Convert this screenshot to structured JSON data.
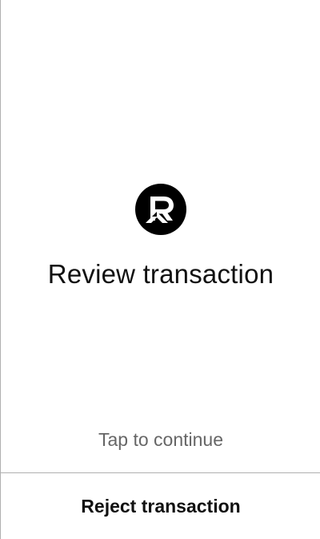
{
  "screen": {
    "logo_icon": "r-brand-logo-icon",
    "title": "Review transaction",
    "tap_hint": "Tap to continue"
  },
  "footer": {
    "reject_label": "Reject transaction"
  },
  "colors": {
    "background": "#ffffff",
    "text": "#111111",
    "hint_text": "#666666",
    "divider": "#b0b0b0"
  }
}
